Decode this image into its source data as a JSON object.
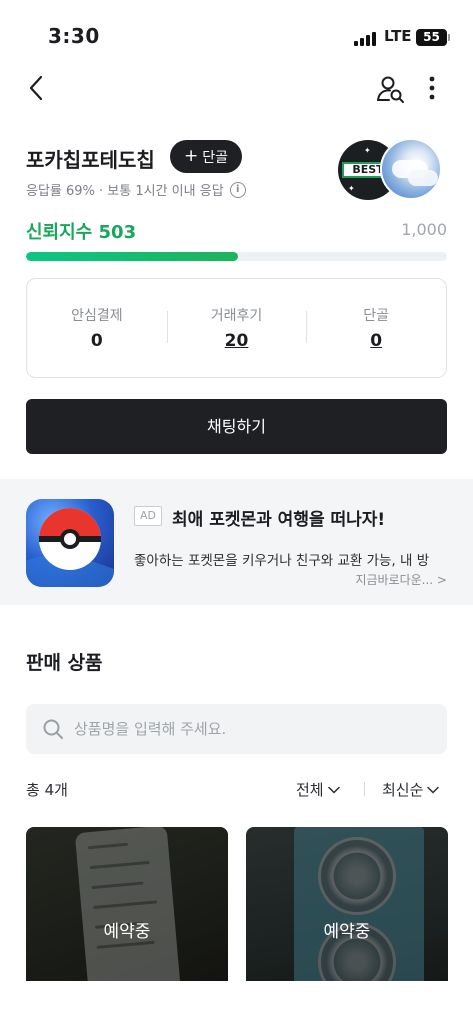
{
  "status_bar": {
    "time": "3:30",
    "network": "LTE",
    "battery": "55"
  },
  "nav": {
    "back_icon": "chevron-left-icon",
    "profile_search_icon": "user-search-icon",
    "more_icon": "more-vertical-icon"
  },
  "profile": {
    "shop_name": "포카칩포테도칩",
    "regular_button": "단골",
    "response_text": "응답률 69% · 보통 1시간 이내 응답",
    "badge_text": "BEST",
    "trust_label": "신뢰지수",
    "trust_value": "503",
    "trust_max": "1,000",
    "trust_fraction": 0.503,
    "accent_color": "#1aa65b"
  },
  "stats": [
    {
      "label": "안심결제",
      "value": "0"
    },
    {
      "label": "거래후기",
      "value": "20"
    },
    {
      "label": "단골",
      "value": "0"
    }
  ],
  "chat_button": "채팅하기",
  "ad": {
    "tag": "AD",
    "title": "최애 포켓몬과 여행을 떠나자!",
    "description": "좋아하는 포켓몬을 키우거나 친구와 교환 가능, 내 방",
    "more": "지금바로다운... >"
  },
  "products": {
    "section_title": "판매 상품",
    "search_placeholder": "상품명을 입력해 주세요.",
    "count": "총 4개",
    "filter": "전체",
    "sort": "최신순",
    "items": [
      {
        "status": "예약중"
      },
      {
        "status": "예약중"
      }
    ]
  }
}
